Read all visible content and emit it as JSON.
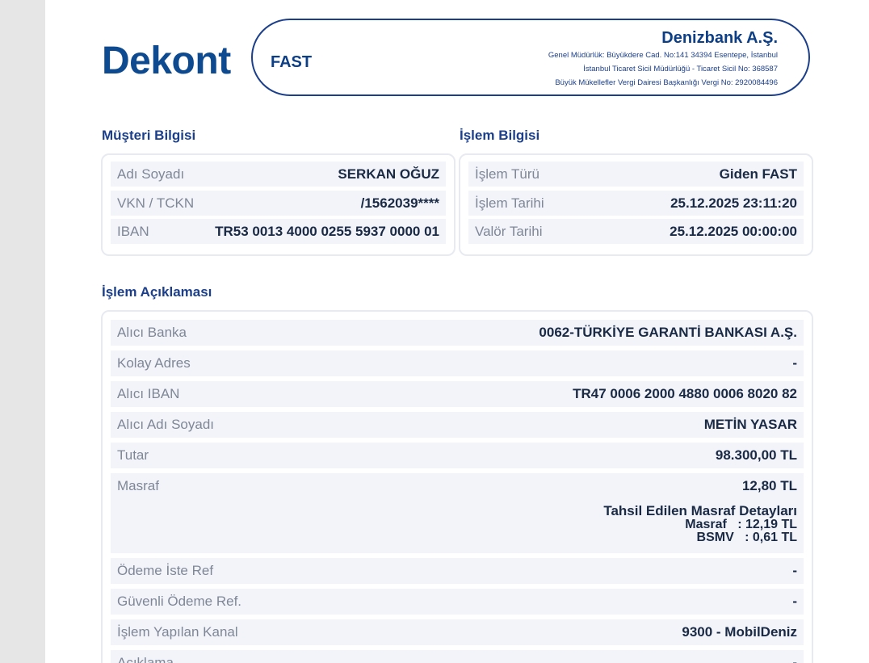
{
  "header": {
    "title": "Dekont",
    "type": "FAST",
    "bank_name": "Denizbank A.Ş.",
    "bank_lines": [
      "Genel Müdürlük: Büyükdere Cad. No:141 34394 Esentepe, İstanbul",
      "İstanbul Ticaret Sicil Müdürlüğü - Ticaret Sicil No: 368587",
      "Büyük Mükellefler Vergi Dairesi Başkanlığı Vergi No: 2920084496"
    ]
  },
  "customer": {
    "title": "Müşteri Bilgisi",
    "rows": [
      {
        "label": "Adı Soyadı",
        "value": "SERKAN OĞUZ"
      },
      {
        "label": "VKN / TCKN",
        "value": "/1562039****"
      },
      {
        "label": "IBAN",
        "value": "TR53 0013 4000 0255 5937 0000 01"
      }
    ]
  },
  "transaction": {
    "title": "İşlem Bilgisi",
    "rows": [
      {
        "label": "İşlem Türü",
        "value": "Giden FAST"
      },
      {
        "label": "İşlem Tarihi",
        "value": "25.12.2025 23:11:20"
      },
      {
        "label": "Valör Tarihi",
        "value": "25.12.2025 00:00:00"
      }
    ]
  },
  "description": {
    "title": "İşlem Açıklaması",
    "rows": [
      {
        "label": "Alıcı Banka",
        "value": "0062-TÜRKİYE GARANTİ BANKASI A.Ş."
      },
      {
        "label": "Kolay Adres",
        "value": "-"
      },
      {
        "label": "Alıcı IBAN",
        "value": "TR47 0006 2000 4880 0006 8020 82"
      },
      {
        "label": "Alıcı Adı Soyadı",
        "value": "METİN YASAR"
      },
      {
        "label": "Tutar",
        "value": "98.300,00 TL"
      },
      {
        "label": "Masraf",
        "value": "12,80 TL"
      },
      {
        "label": "Ödeme İste Ref",
        "value": "-"
      },
      {
        "label": "Güvenli Ödeme Ref.",
        "value": "-"
      },
      {
        "label": "İşlem Yapılan Kanal",
        "value": "9300 - MobilDeniz"
      },
      {
        "label": "Açıklama",
        "value": "-"
      }
    ],
    "fee_details": {
      "heading": "Tahsil Edilen Masraf Detayları",
      "lines": [
        "Masraf   : 12,19 TL",
        "BSMV   : 0,61 TL"
      ]
    }
  }
}
